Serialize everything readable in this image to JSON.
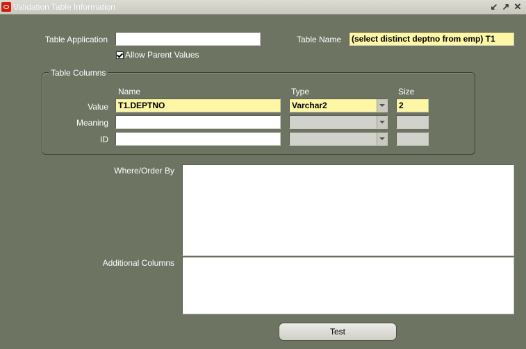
{
  "window": {
    "title": "Validation Table Information",
    "controls": [
      "minimize-icon",
      "maximize-icon",
      "close-icon"
    ]
  },
  "form": {
    "table_application_label": "Table Application",
    "table_application_value": "",
    "table_name_label": "Table Name",
    "table_name_value": "(select distinct deptno from emp) T1",
    "allow_parent_values_label": "Allow Parent Values",
    "allow_parent_values_checked": true
  },
  "columns_group": {
    "title": "Table Columns",
    "headers": {
      "name": "Name",
      "type": "Type",
      "size": "Size"
    },
    "rows": [
      {
        "label": "Value",
        "name": "T1.DEPTNO",
        "type": "Varchar2",
        "size": "2"
      },
      {
        "label": "Meaning",
        "name": "",
        "type": "",
        "size": ""
      },
      {
        "label": "ID",
        "name": "",
        "type": "",
        "size": ""
      }
    ]
  },
  "where_order_by": {
    "label": "Where/Order By",
    "value": ""
  },
  "additional_columns": {
    "label": "Additional Columns",
    "value": ""
  },
  "test_button": {
    "label": "Test",
    "mnemonic": "s"
  },
  "colors": {
    "background": "#6e7462",
    "required_field": "#fcf6a5",
    "disabled_field": "#d2d2cc"
  }
}
